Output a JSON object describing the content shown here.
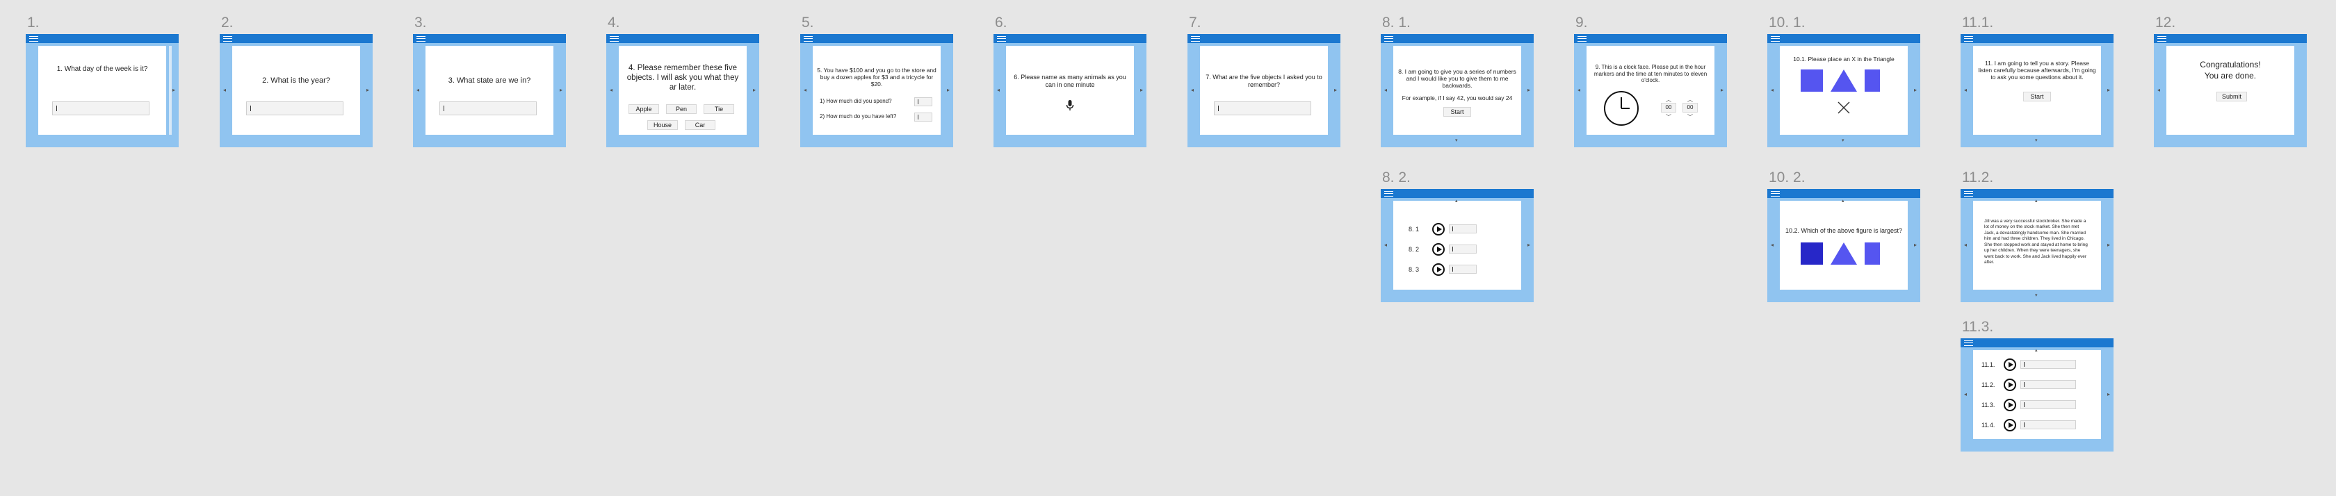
{
  "frames": {
    "f1": {
      "label": "1.",
      "question": "1. What day of the week is it?"
    },
    "f2": {
      "label": "2.",
      "question": "2. What is the year?"
    },
    "f3": {
      "label": "3.",
      "question": "3. What state are we in?"
    },
    "f4": {
      "label": "4.",
      "question": "4. Please remember these five objects. I will ask you what they ar later.",
      "objects": [
        "Apple",
        "Pen",
        "Tie",
        "House",
        "Car"
      ]
    },
    "f5": {
      "label": "5.",
      "question": "5. You have $100 and you go to the store and buy a dozen apples for $3 and a tricycle for $20.",
      "q1": "1) How much did you spend?",
      "q2": "2) How much do you have left?"
    },
    "f6": {
      "label": "6.",
      "question": "6. Please name as many animals as you can in one minute"
    },
    "f7": {
      "label": "7.",
      "question": "7. What are the five objects I asked you to remember?"
    },
    "f8_1": {
      "label": "8. 1.",
      "question": "8. I am going to give you a series of numbers and I would like you to give them to me backwards.",
      "example": "For example, if I say 42, you would say 24",
      "button": "Start"
    },
    "f8_2": {
      "label": "8. 2.",
      "rows": [
        "8. 1",
        "8. 2",
        "8. 3"
      ]
    },
    "f9": {
      "label": "9.",
      "question": "9. This is a clock face. Please put in the hour markers and the time at ten minutes to eleven o'clock.",
      "hour": "00",
      "minute": "00"
    },
    "f10_1": {
      "label": "10. 1.",
      "question": "10.1. Please place an X in the Triangle"
    },
    "f10_2": {
      "label": "10. 2.",
      "question": "10.2. Which of the above figure is largest?"
    },
    "f11_1": {
      "label": "11.1.",
      "question": "11. I am going to tell you a story. Please listen carefully because afterwards, I'm going to ask you some questions about it.",
      "button": "Start"
    },
    "f11_2": {
      "label": "11.2.",
      "story": "Jill was a very successful stockbroker. She made a lot of money on the stock market. She then met Jack, a devastatingly handsome man. She married him and had three children. They lived in Chicago. She then stopped work and stayed at home to bring up her children. When they were teenagers, she went back to work. She and Jack lived happily ever after."
    },
    "f11_3": {
      "label": "11.3.",
      "rows": [
        "11.1.",
        "11.2.",
        "11.3.",
        "11.4."
      ]
    },
    "f12": {
      "label": "12.",
      "line1": "Congratulations!",
      "line2": "You are done.",
      "button": "Submit"
    }
  },
  "icons": {
    "menu": "menu-icon",
    "mic": "microphone-icon",
    "play": "play-icon",
    "clock": "clock-icon",
    "close": "x-mark-icon"
  },
  "colors": {
    "appbar": "#1b78d0",
    "frame_bg": "#90c4f0",
    "shape_blue": "#5555f0",
    "shape_dark_blue": "#2727c8"
  }
}
